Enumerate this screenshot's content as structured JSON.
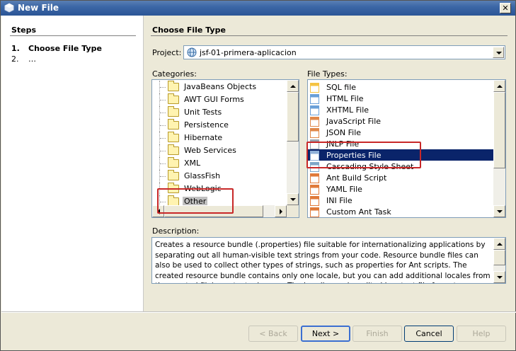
{
  "window": {
    "title": "New File",
    "close_label": "✕"
  },
  "steps": {
    "title": "Steps",
    "items": [
      {
        "num": "1.",
        "label": "Choose File Type"
      },
      {
        "num": "2.",
        "label": "…"
      }
    ]
  },
  "main": {
    "title": "Choose File Type",
    "project_label": "Project:",
    "project_value": "jsf-01-primera-aplicacion",
    "categories_label": "Categories:",
    "file_types_label": "File Types:",
    "description_label": "Description:",
    "description_text": "Creates a resource bundle (.properties) file suitable for internationalizing applications by separating out all human-visible text strings from your code. Resource bundle files can also be used to collect other types of strings, such as properties for Ant scripts. The created resource bundle contains only one locale, but you can add additional locales from the created file's contextual menu. The bundle can be edited in a text file format (.properties) or in a specific kind of table."
  },
  "categories": [
    {
      "label": "JavaBeans Objects"
    },
    {
      "label": "AWT GUI Forms"
    },
    {
      "label": "Unit Tests"
    },
    {
      "label": "Persistence"
    },
    {
      "label": "Hibernate"
    },
    {
      "label": "Web Services"
    },
    {
      "label": "XML"
    },
    {
      "label": "GlassFish"
    },
    {
      "label": "WebLogic"
    },
    {
      "label": "Other",
      "selected": true
    }
  ],
  "file_types": [
    {
      "label": "SQL file",
      "icon": "sql-file-icon"
    },
    {
      "label": "HTML File",
      "icon": "html-file-icon"
    },
    {
      "label": "XHTML File",
      "icon": "xhtml-file-icon"
    },
    {
      "label": "JavaScript File",
      "icon": "javascript-file-icon"
    },
    {
      "label": "JSON File",
      "icon": "json-file-icon"
    },
    {
      "label": "JNLP File",
      "icon": "jnlp-file-icon"
    },
    {
      "label": "Properties File",
      "icon": "properties-file-icon",
      "selected": true
    },
    {
      "label": "Cascading Style Sheet",
      "icon": "css-file-icon"
    },
    {
      "label": "Ant Build Script",
      "icon": "ant-script-icon"
    },
    {
      "label": "YAML File",
      "icon": "yaml-file-icon"
    },
    {
      "label": "INI File",
      "icon": "ini-file-icon"
    },
    {
      "label": "Custom Ant Task",
      "icon": "ant-task-icon"
    }
  ],
  "buttons": {
    "back": "< Back",
    "next": "Next >",
    "finish": "Finish",
    "cancel": "Cancel",
    "help": "Help"
  },
  "colors": {
    "title_bar": "#2b5596",
    "selection": "#0a246a",
    "highlight_annotation": "#c82828"
  }
}
